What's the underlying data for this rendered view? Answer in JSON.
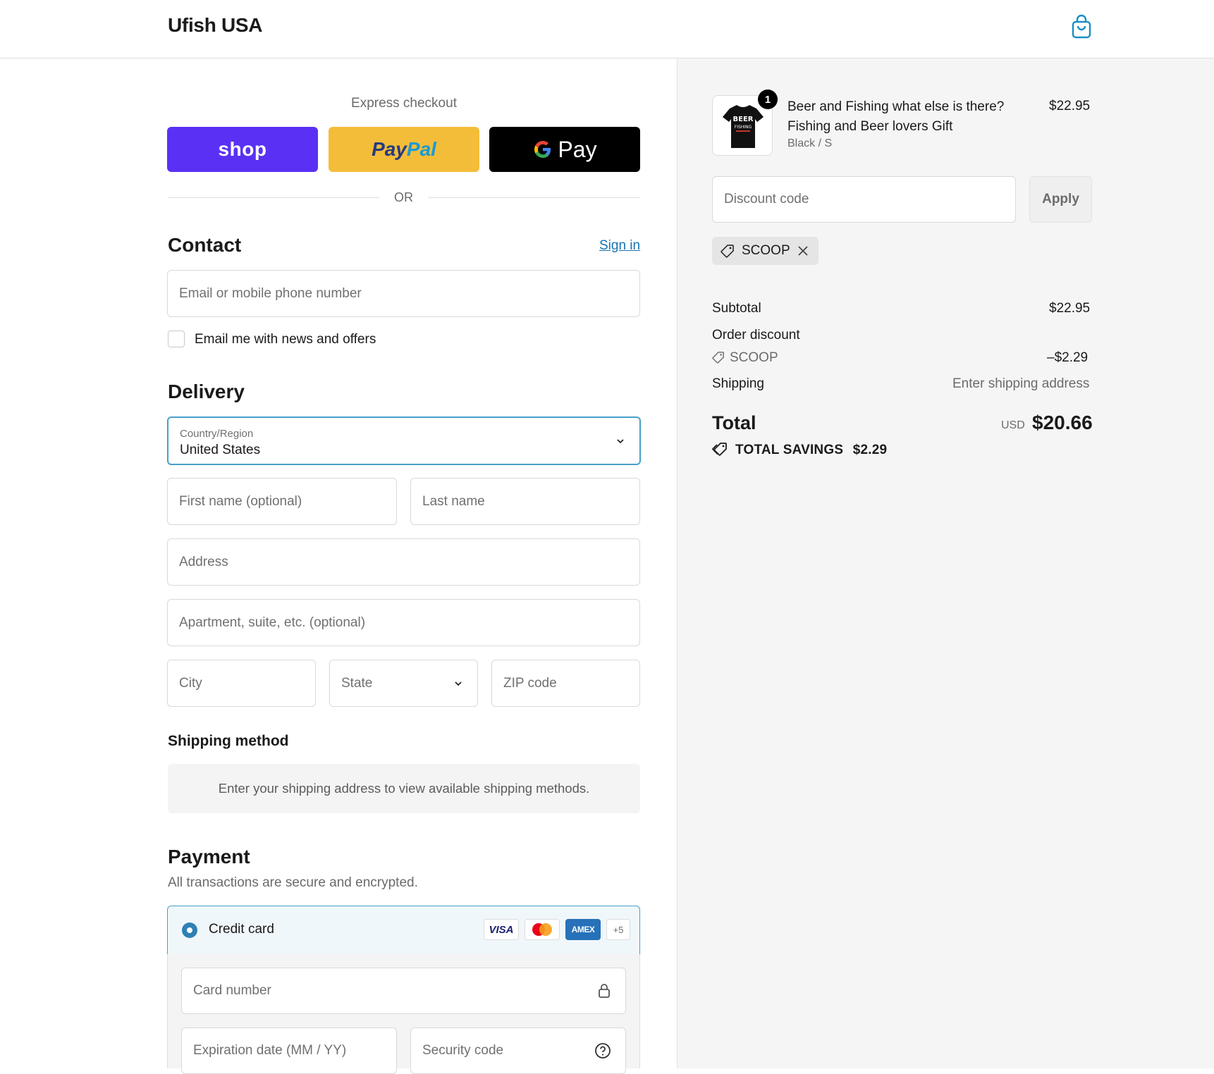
{
  "header": {
    "brand": "Ufish USA",
    "cart_icon": "shopping-bag-icon"
  },
  "express": {
    "label": "Express checkout",
    "shop_label": "shop",
    "paypal_part1": "Pay",
    "paypal_part2": "Pal",
    "gpay_label": "Pay",
    "or_label": "OR"
  },
  "contact": {
    "title": "Contact",
    "sign_in": "Sign in",
    "email_placeholder": "Email or mobile phone number",
    "news_label": "Email me with news and offers"
  },
  "delivery": {
    "title": "Delivery",
    "country_label": "Country/Region",
    "country_value": "United States",
    "first_name_placeholder": "First name (optional)",
    "last_name_placeholder": "Last name",
    "address_placeholder": "Address",
    "apartment_placeholder": "Apartment, suite, etc. (optional)",
    "city_placeholder": "City",
    "state_placeholder": "State",
    "zip_placeholder": "ZIP code"
  },
  "shipping_method": {
    "title": "Shipping method",
    "message": "Enter your shipping address to view available shipping methods."
  },
  "payment": {
    "title": "Payment",
    "subtitle": "All transactions are secure and encrypted.",
    "credit_card_label": "Credit card",
    "card_brands": [
      "VISA",
      "AMEX"
    ],
    "more_brands": "+5",
    "card_number_placeholder": "Card number",
    "expiration_placeholder": "Expiration date (MM / YY)",
    "security_code_placeholder": "Security code"
  },
  "order": {
    "product_name": "Beer and Fishing what else is there? Fishing and Beer lovers Gift",
    "variant": "Black / S",
    "price": "$22.95",
    "quantity": "1",
    "thumb_text_1": "BEER",
    "thumb_text_2": "FISHING"
  },
  "discount": {
    "placeholder": "Discount code",
    "apply_label": "Apply",
    "applied_code": "SCOOP"
  },
  "summary": {
    "subtotal_label": "Subtotal",
    "subtotal_value": "$22.95",
    "order_discount_label": "Order discount",
    "discount_code": "SCOOP",
    "discount_value": "–$2.29",
    "shipping_label": "Shipping",
    "shipping_value": "Enter shipping address",
    "total_label": "Total",
    "currency": "USD",
    "total_value": "$20.66",
    "savings_label": "TOTAL SAVINGS",
    "savings_value": "$2.29"
  },
  "colors": {
    "shop_purple": "#5a31f4",
    "paypal_yellow": "#f4bd39",
    "link_blue": "#1773b0",
    "focus_blue": "#4a9fc8"
  }
}
